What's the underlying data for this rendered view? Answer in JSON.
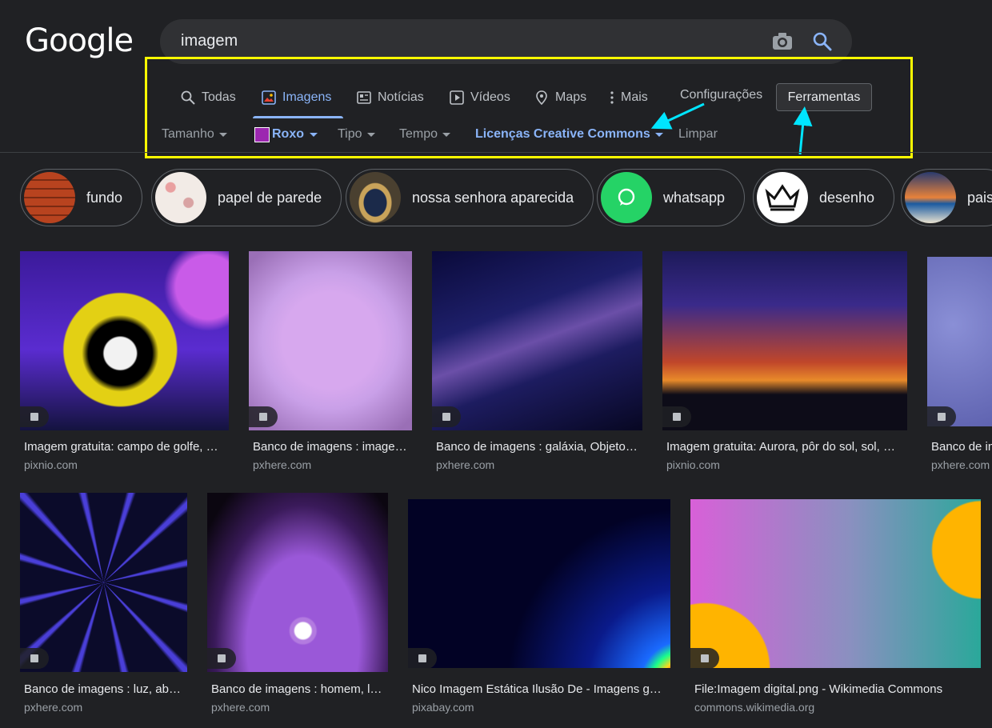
{
  "logo": "Google",
  "search": {
    "query": "imagem",
    "camera_icon": "camera-icon",
    "search_icon": "search-icon"
  },
  "tabs": [
    {
      "label": "Todas",
      "icon": "search-icon"
    },
    {
      "label": "Imagens",
      "icon": "image-icon",
      "active": true
    },
    {
      "label": "Notícias",
      "icon": "news-icon"
    },
    {
      "label": "Vídeos",
      "icon": "play-icon"
    },
    {
      "label": "Maps",
      "icon": "map-pin-icon"
    },
    {
      "label": "Mais",
      "icon": "more-vert-icon"
    },
    {
      "label": "Configurações"
    }
  ],
  "tools_button": "Ferramentas",
  "filters": [
    {
      "label": "Tamanho"
    },
    {
      "label": "Roxo",
      "color": "#9c27b0",
      "active": true
    },
    {
      "label": "Tipo"
    },
    {
      "label": "Tempo"
    },
    {
      "label": "Licenças Creative Commons",
      "active": true
    },
    {
      "label": "Limpar"
    }
  ],
  "annotation": {
    "highlight_color": "#ffff00",
    "arrow_color": "#00e5ff"
  },
  "chips": [
    {
      "label": "fundo"
    },
    {
      "label": "papel de parede"
    },
    {
      "label": "nossa senhora aparecida"
    },
    {
      "label": "whatsapp"
    },
    {
      "label": "desenho"
    },
    {
      "label": "pais"
    }
  ],
  "results": [
    {
      "title": "Imagem gratuita: campo de golfe, …",
      "source": "pixnio.com"
    },
    {
      "title": "Banco de imagens : image…",
      "source": "pxhere.com"
    },
    {
      "title": "Banco de imagens : galáxia, Objeto…",
      "source": "pxhere.com"
    },
    {
      "title": "Imagem gratuita: Aurora, pôr do sol, sol, …",
      "source": "pixnio.com"
    },
    {
      "title": "Banco de im",
      "source": "pxhere.com"
    },
    {
      "title": "Banco de imagens : luz, ab…",
      "source": "pxhere.com"
    },
    {
      "title": "Banco de imagens : homem, l…",
      "source": "pxhere.com"
    },
    {
      "title": "Nico Imagem Estática Ilusão De - Imagens g…",
      "source": "pixabay.com"
    },
    {
      "title": "File:Imagem digital.png - Wikimedia Commons",
      "source": "commons.wikimedia.org"
    }
  ]
}
